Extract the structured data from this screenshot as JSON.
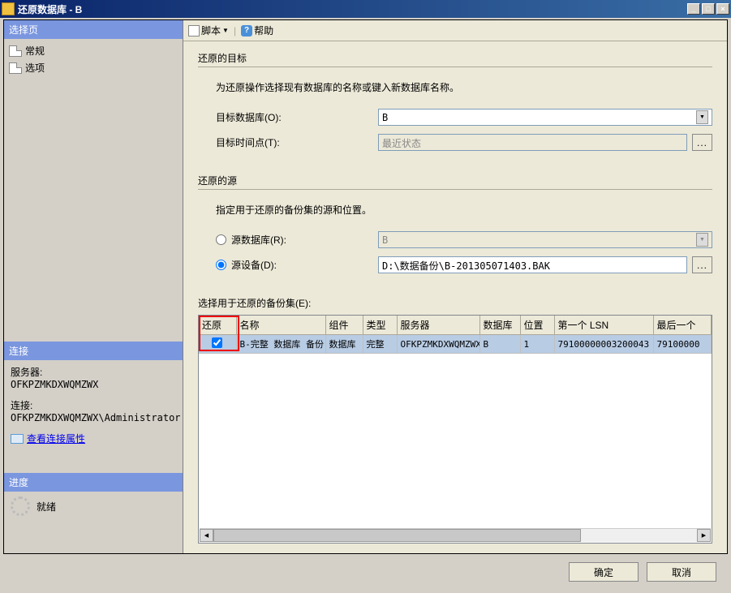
{
  "window": {
    "title": "还原数据库 - B"
  },
  "sidebar": {
    "select_header": "选择页",
    "pages": [
      "常规",
      "选项"
    ],
    "conn_header": "连接",
    "server_label": "服务器:",
    "server_value": "OFKPZMKDXWQMZWX",
    "conn_label": "连接:",
    "conn_value": "OFKPZMKDXWQMZWX\\Administrator",
    "view_props": "查看连接属性",
    "progress_header": "进度",
    "progress_status": "就绪"
  },
  "toolbar": {
    "script": "脚本",
    "help": "帮助"
  },
  "form": {
    "dest_title": "还原的目标",
    "dest_desc": "为还原操作选择现有数据库的名称或键入新数据库名称。",
    "dest_db_label": "目标数据库(O):",
    "dest_db_value": "B",
    "dest_time_label": "目标时间点(T):",
    "dest_time_value": "最近状态",
    "src_title": "还原的源",
    "src_desc": "指定用于还原的备份集的源和位置。",
    "src_db_label": "源数据库(R):",
    "src_db_value": "B",
    "src_device_label": "源设备(D):",
    "src_device_value": "D:\\数据备份\\B-201305071403.BAK",
    "grid_label": "选择用于还原的备份集(E):"
  },
  "grid": {
    "headers": [
      "还原",
      "名称",
      "组件",
      "类型",
      "服务器",
      "数据库",
      "位置",
      "第一个 LSN",
      "最后一个"
    ],
    "row": {
      "checked": true,
      "name": "B-完整 数据库 备份",
      "component": "数据库",
      "type": "完整",
      "server": "OFKPZMKDXWQMZWX",
      "database": "B",
      "position": "1",
      "first_lsn": "79100000003200043",
      "last_lsn": "79100000"
    }
  },
  "buttons": {
    "ok": "确定",
    "cancel": "取消"
  }
}
